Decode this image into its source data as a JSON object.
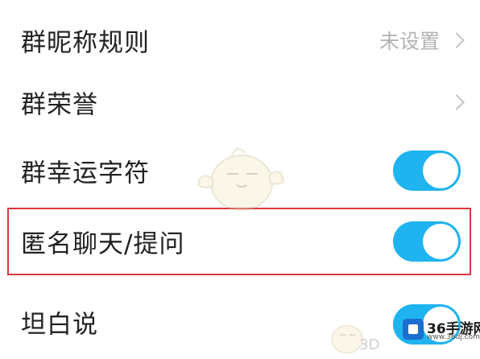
{
  "settings": {
    "rows": [
      {
        "label": "群昵称规则",
        "value": "未设置",
        "control": "chevron-link"
      },
      {
        "label": "群荣誉",
        "value": "",
        "control": "chevron-link"
      },
      {
        "label": "群幸运字符",
        "value": "",
        "control": "toggle",
        "checked": true
      },
      {
        "label": "匿名聊天/提问",
        "value": "",
        "control": "toggle",
        "checked": true
      },
      {
        "label": "坦白说",
        "value": "",
        "control": "toggle",
        "checked": true
      }
    ]
  },
  "colors": {
    "toggle_on": "#1fb3ef",
    "highlight_border": "#d9363e",
    "value_text": "#b3b3b3"
  },
  "watermark": {
    "text": "3D",
    "brand_name": "36手游网",
    "brand_url": "www.36dj.com"
  }
}
